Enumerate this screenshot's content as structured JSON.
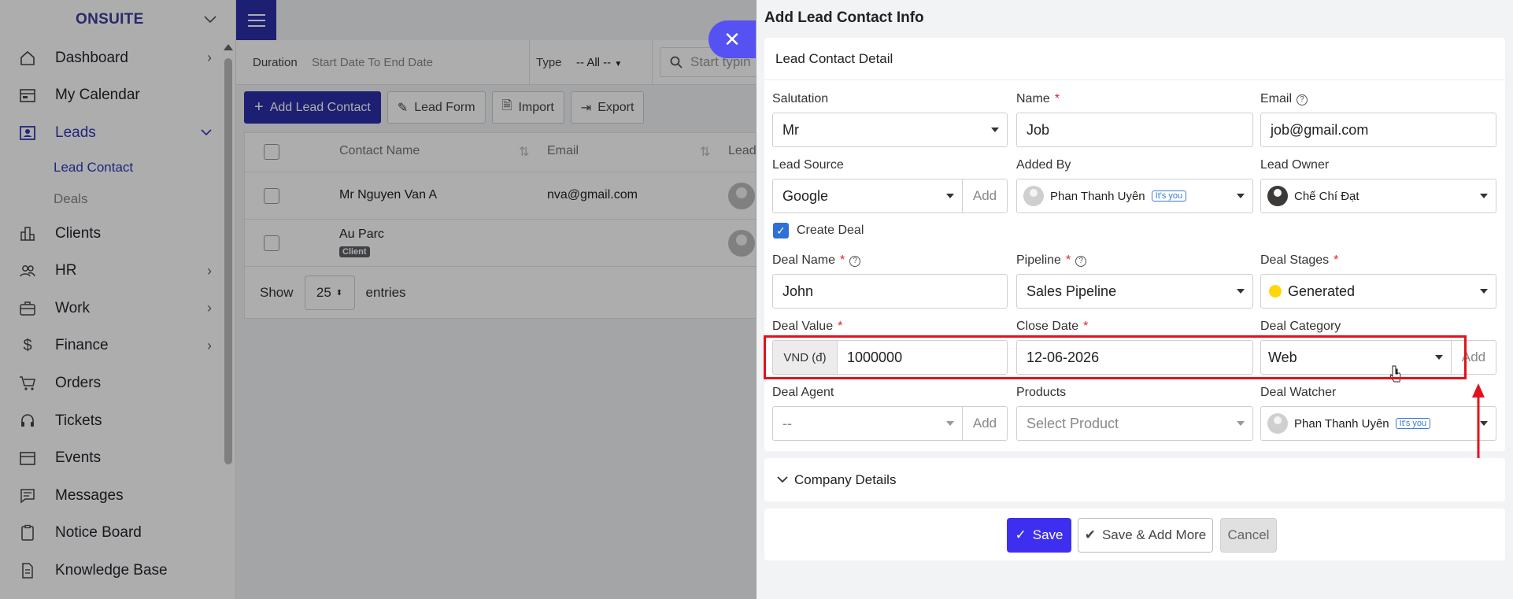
{
  "sidebar": {
    "brand": "ONSUITE",
    "items": [
      {
        "label": "Dashboard",
        "icon": "home-icon"
      },
      {
        "label": "My Calendar",
        "icon": "calendar-icon"
      },
      {
        "label": "Leads",
        "icon": "contact-card-icon"
      },
      {
        "label": "Clients",
        "icon": "building-icon"
      },
      {
        "label": "HR",
        "icon": "users-icon"
      },
      {
        "label": "Work",
        "icon": "briefcase-icon"
      },
      {
        "label": "Finance",
        "icon": "dollar-icon"
      },
      {
        "label": "Orders",
        "icon": "cart-icon"
      },
      {
        "label": "Tickets",
        "icon": "headset-icon"
      },
      {
        "label": "Events",
        "icon": "event-calendar-icon"
      },
      {
        "label": "Messages",
        "icon": "message-icon"
      },
      {
        "label": "Notice Board",
        "icon": "clipboard-icon"
      },
      {
        "label": "Knowledge Base",
        "icon": "document-icon"
      }
    ],
    "sub_items": {
      "lead_contact": "Lead Contact",
      "deals": "Deals"
    }
  },
  "filters": {
    "duration_label": "Duration",
    "duration_value": "Start Date To End Date",
    "type_label": "Type",
    "type_value": "-- All --",
    "search_placeholder": "Start typin"
  },
  "toolbar": {
    "add_lead_contact": "Add Lead Contact",
    "lead_form": "Lead Form",
    "import": "Import",
    "export": "Export"
  },
  "table": {
    "columns": {
      "contact_name": "Contact Name",
      "email": "Email",
      "lead": "Lead"
    },
    "rows": [
      {
        "name": "Mr Nguyen Van A",
        "email": "nva@gmail.com"
      },
      {
        "name": "Au Parc",
        "badge": "Client",
        "email": ""
      }
    ]
  },
  "entries": {
    "show": "Show",
    "count": "25",
    "suffix": "entries"
  },
  "drawer": {
    "title": "Add Lead Contact Info",
    "section_title": "Lead Contact Detail",
    "salutation": {
      "label": "Salutation",
      "value": "Mr"
    },
    "name": {
      "label": "Name",
      "value": "Job"
    },
    "email": {
      "label": "Email",
      "value": "job@gmail.com"
    },
    "lead_source": {
      "label": "Lead Source",
      "value": "Google",
      "add": "Add"
    },
    "added_by": {
      "label": "Added By",
      "value": "Phan Thanh Uyên",
      "tag": "It's you"
    },
    "lead_owner": {
      "label": "Lead Owner",
      "value": "Chế Chí Đạt"
    },
    "create_deal": "Create Deal",
    "deal_name": {
      "label": "Deal Name",
      "value": "John"
    },
    "pipeline": {
      "label": "Pipeline",
      "value": "Sales Pipeline"
    },
    "deal_stages": {
      "label": "Deal Stages",
      "value": "Generated",
      "color": "#ffd60a"
    },
    "deal_value": {
      "label": "Deal Value",
      "currency": "VND (đ)",
      "value": "1000000"
    },
    "close_date": {
      "label": "Close Date",
      "value": "12-06-2026"
    },
    "deal_category": {
      "label": "Deal Category",
      "value": "Web",
      "add": "Add"
    },
    "deal_agent": {
      "label": "Deal Agent",
      "value": "--",
      "add": "Add"
    },
    "products": {
      "label": "Products",
      "placeholder": "Select Product"
    },
    "deal_watcher": {
      "label": "Deal Watcher",
      "value": "Phan Thanh Uyên",
      "tag": "It's you"
    },
    "company_details": "Company Details",
    "buttons": {
      "save": "Save",
      "save_more": "Save & Add More",
      "cancel": "Cancel"
    },
    "close_icon": "close-icon"
  },
  "colors": {
    "primary": "#2c2fa8",
    "save": "#3e2ff0",
    "highlight": "#e4111b",
    "checkbox": "#2f6fd6"
  }
}
